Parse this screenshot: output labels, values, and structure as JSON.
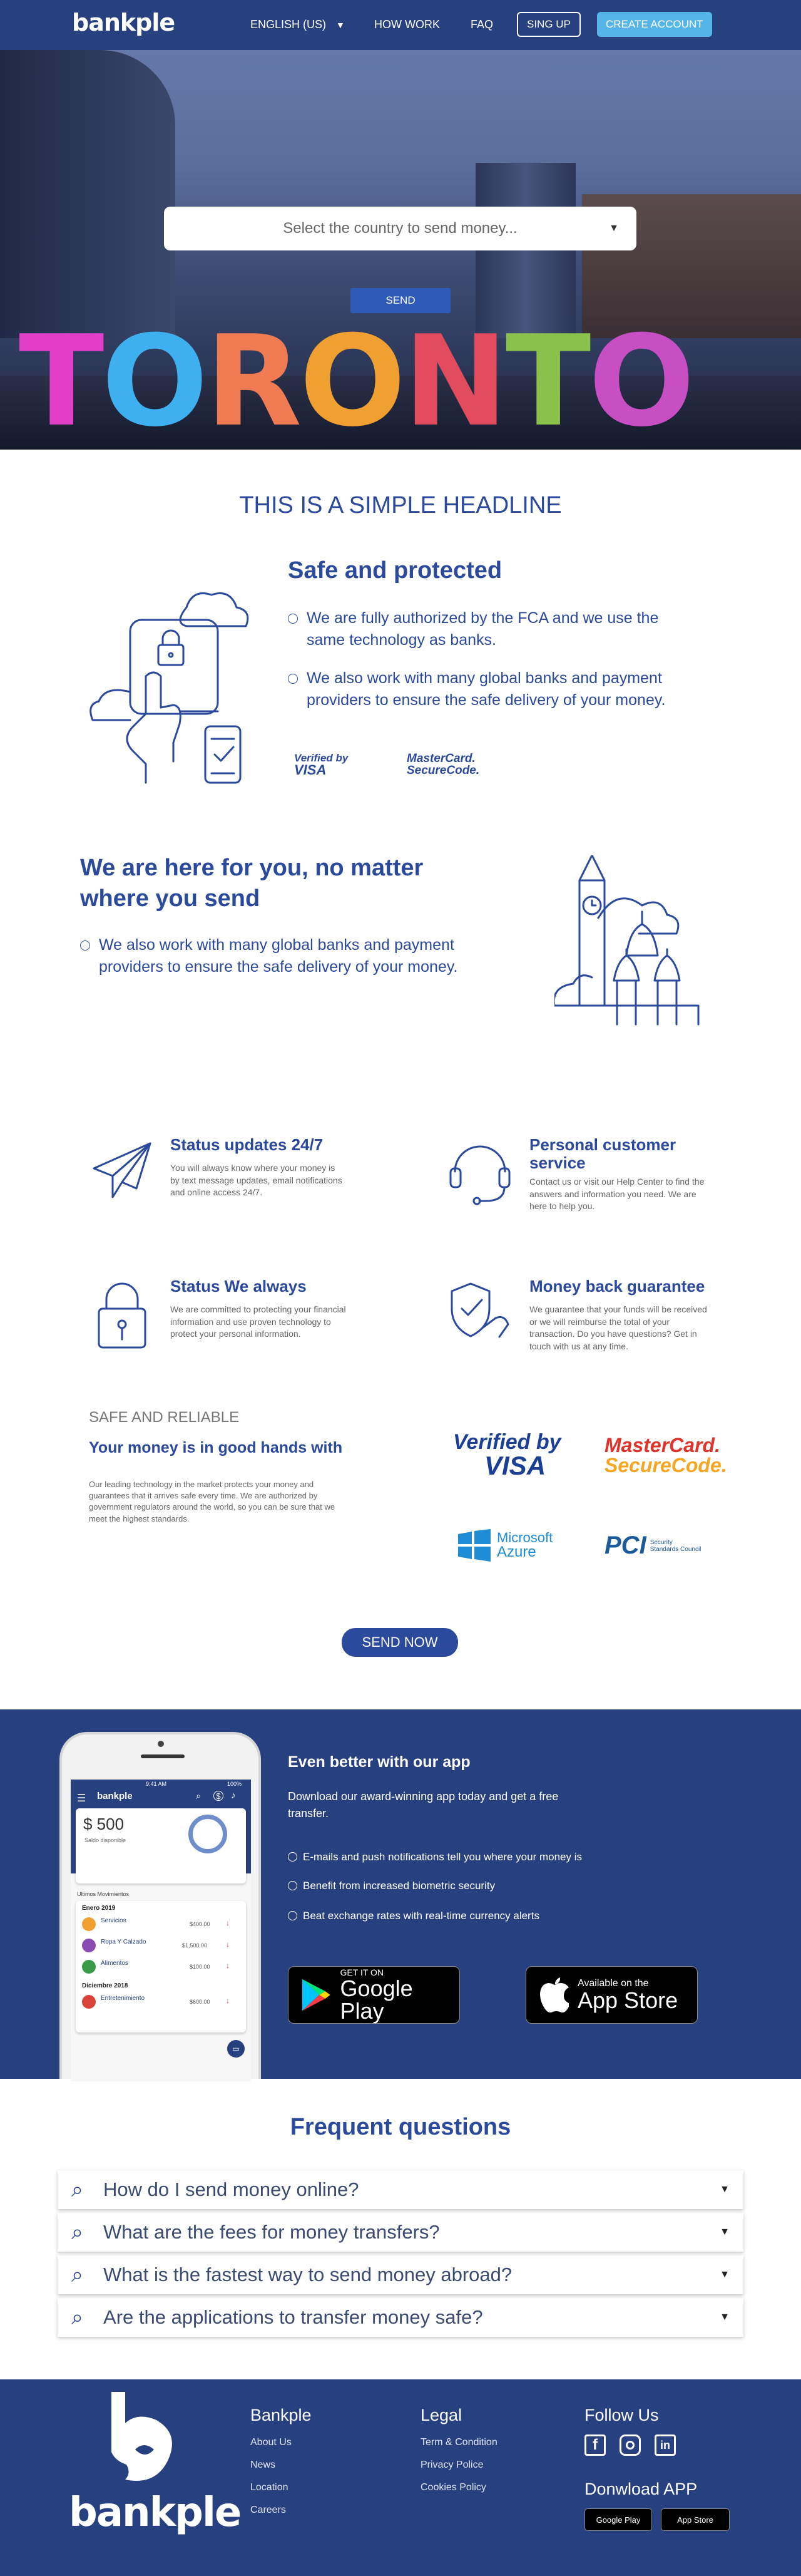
{
  "brand": {
    "name": "bankple"
  },
  "nav": {
    "language": "ENGLISH (US)",
    "how_work": "HOW WORK",
    "faq": "FAQ",
    "sign_up": "SING UP",
    "create_account": "CREATE ACCOUNT"
  },
  "hero": {
    "select_placeholder": "Select the country to send money...",
    "send_label": "SEND",
    "sign_text": "TORONTO"
  },
  "headline": "THIS IS A SIMPLE HEADLINE",
  "safe": {
    "title": "Safe and protected",
    "bullets": [
      "We are fully authorized by the FCA and we use the same technology as banks.",
      "We also work with many global banks and payment providers to ensure the safe delivery of your money."
    ],
    "badge_visa_top": "Verified by",
    "badge_visa_bottom": "VISA",
    "badge_mc_top": "MasterCard.",
    "badge_mc_bottom": "SecureCode."
  },
  "here": {
    "title": "We are here for you, no matter where you send",
    "bullet": "We also work with many global banks and payment providers to ensure the safe delivery of your money."
  },
  "features": [
    {
      "title": "Status updates 24/7",
      "text": "You will always know where your money is by text message updates, email notifications and online access 24/7."
    },
    {
      "title": "Personal customer service",
      "text": "Contact us or visit our Help Center to find the answers and information you need. We are here to help you."
    },
    {
      "title": "Status We always",
      "text": "We are committed to protecting your financial information and use proven technology to protect your personal information."
    },
    {
      "title": "Money back guarantee",
      "text": "We guarantee that your funds will be received or we will reimburse the total of your transaction. Do you have questions? Get in touch with us at any time."
    }
  ],
  "reliable": {
    "kicker": "SAFE AND RELIABLE",
    "title": "Your money is in good hands with",
    "text": "Our leading technology in the market protects your money and guarantees that it arrives safe every time. We are authorized by government regulators around the world, so you can be sure that we meet the highest standards.",
    "logos": {
      "visa_top": "Verified by",
      "visa_bottom": "VISA",
      "mc_top": "MasterCard.",
      "mc_bottom": "SecureCode.",
      "azure_top": "Microsoft",
      "azure_bottom": "Azure",
      "pci": "PCI",
      "pci_sub1": "Security",
      "pci_sub2": "Standards Council"
    },
    "send_now": "SEND NOW"
  },
  "app": {
    "title": "Even better with our app",
    "subtitle": "Download our award-winning app today and get a free transfer.",
    "bullets": [
      "E-mails and push notifications tell you where your money is",
      "Benefit from increased biometric security",
      "Beat exchange rates with real-time currency alerts"
    ],
    "google_small": "GET IT ON",
    "google_big": "Google Play",
    "apple_small": "Available on the",
    "apple_big": "App Store",
    "phone": {
      "time": "9:41 AM",
      "battery": "100%",
      "balance": "$ 500",
      "balance_label": "Saldo disponible",
      "month_label": "Ultimos Movimientos",
      "group1": "Enero 2019",
      "group2": "Diciembre 2018",
      "items": [
        {
          "name": "Servicios",
          "amount": "$400.00"
        },
        {
          "name": "Ropa Y Calzado",
          "amount": "$1,500.00"
        },
        {
          "name": "Alimentos",
          "amount": "$100.00"
        },
        {
          "name": "Entretenimiento",
          "amount": "$600.00"
        }
      ]
    }
  },
  "faq": {
    "title": "Frequent questions",
    "questions": [
      "How do I send money online?",
      "What are the fees for money transfers?",
      "What is the fastest way to send money abroad?",
      "Are the applications to transfer money safe?"
    ]
  },
  "footer": {
    "col1_title": "Bankple",
    "col1": [
      "About Us",
      "News",
      "Location",
      "Careers"
    ],
    "col2_title": "Legal",
    "col2": [
      "Term & Condition",
      "Privacy Police",
      "Cookies Policy"
    ],
    "follow_title": "Follow Us",
    "download_title": "Donwload APP",
    "mini_google": "Google Play",
    "mini_apple": "App Store"
  },
  "colors": {
    "brand_navy": "#27407f",
    "accent_blue": "#55b5e8",
    "heading_blue": "#2b4a9b"
  }
}
